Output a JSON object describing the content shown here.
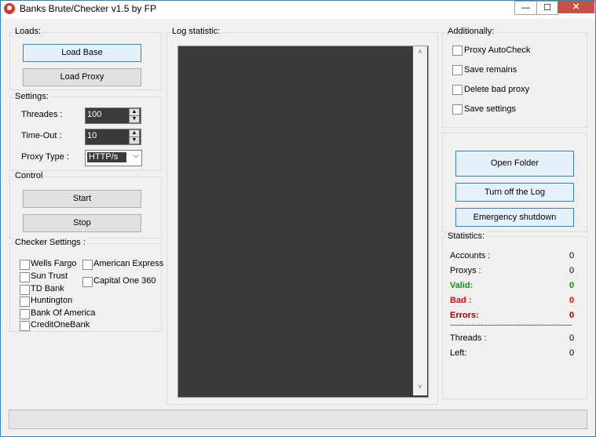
{
  "window": {
    "title": "Banks Brute/Checker v1.5 by FP",
    "min_label": "—",
    "max_label": "☐",
    "close_label": "✕"
  },
  "loads": {
    "label": "Loads:",
    "load_base": "Load Base",
    "load_proxy": "Load Proxy"
  },
  "settings": {
    "label": "Settings:",
    "threads_label": "Threades :",
    "threads_value": "100",
    "timeout_label": "Time-Out :",
    "timeout_value": "10",
    "proxy_type_label": "Proxy Type :",
    "proxy_type_value": "HTTP/s"
  },
  "control": {
    "label": "Control",
    "start": "Start",
    "stop": "Stop"
  },
  "checker": {
    "label": "Checker Settings :",
    "banks": [
      "Wells Fargo",
      "Sun Trust",
      "TD Bank",
      "Huntington",
      "Bank Of America",
      "CreditOneBank",
      "American Express",
      "Capital One 360"
    ]
  },
  "log": {
    "label": "Log statistic:",
    "scroll_up": "˄",
    "scroll_down": "˅"
  },
  "additionally": {
    "label": "Additionally:",
    "options": [
      "Proxy AutoCheck",
      "Save remains",
      "Delete bad proxy",
      "Save settings"
    ]
  },
  "actions": {
    "open_folder": "Open Folder",
    "turn_off_log": "Turn off the Log",
    "emergency": "Emergency shutdown"
  },
  "statistics": {
    "label": "Statistics:",
    "accounts_label": "Accounts :",
    "accounts": "0",
    "proxys_label": "Proxys :",
    "proxys": "0",
    "valid_label": "Valid:",
    "valid": "0",
    "bad_label": "Bad :",
    "bad": "0",
    "errors_label": "Errors:",
    "errors": "0",
    "separator": "----------------------------------------------------",
    "threads_label": "Threads :",
    "threads": "0",
    "left_label": "Left:",
    "left": "0"
  },
  "colors": {
    "valid": "#1a8a1a",
    "bad": "#d01010",
    "errors": "#a00000",
    "accent": "#3c7fb1"
  }
}
